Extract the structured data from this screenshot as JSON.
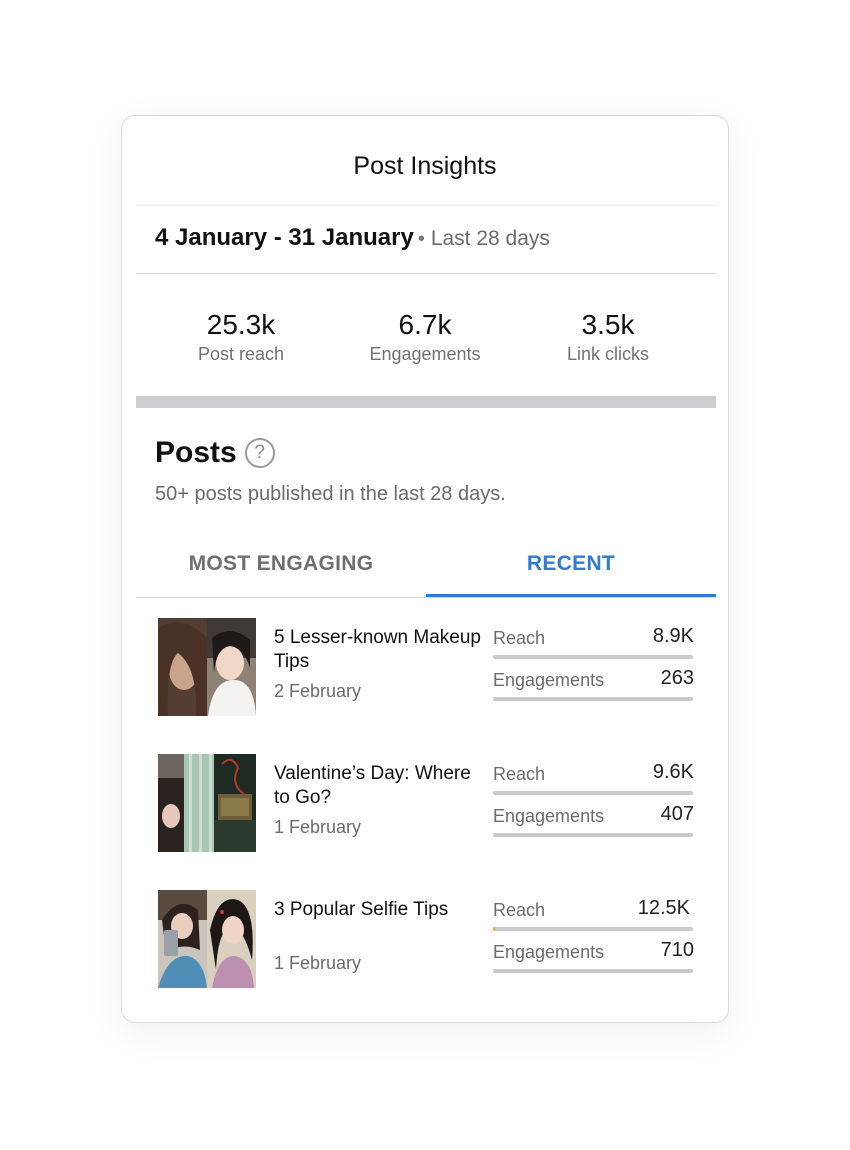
{
  "header": {
    "title": "Post Insights"
  },
  "date": {
    "range": "4 January - 31 January",
    "separator": "•",
    "period": "Last 28 days"
  },
  "stats": [
    {
      "value": "25.3k",
      "label": "Post reach"
    },
    {
      "value": "6.7k",
      "label": "Engagements"
    },
    {
      "value": "3.5k",
      "label": "Link clicks"
    }
  ],
  "posts": {
    "heading": "Posts",
    "help_glyph": "?",
    "subtitle": "50+ posts published in the last 28 days.",
    "tabs": [
      {
        "label": "MOST ENGAGING",
        "active": false
      },
      {
        "label": "RECENT",
        "active": true
      }
    ],
    "items": [
      {
        "title": "5 Lesser-known Makeup Tips",
        "date": "2 February",
        "reach_label": "Reach",
        "reach": "8.9K",
        "eng_label": "Engagements",
        "engagements": "263",
        "reach_fill": 0.0,
        "eng_fill": 0.0
      },
      {
        "title": "Valentine’s Day: Where to Go?",
        "date": "1 February",
        "reach_label": "Reach",
        "reach": "9.6K",
        "eng_label": "Engagements",
        "engagements": "407",
        "reach_fill": 0.0,
        "eng_fill": 0.0
      },
      {
        "title": "3 Popular Selfie Tips",
        "date": "1 February",
        "reach_label": "Reach",
        "reach": "12.5K",
        "eng_label": "Engagements",
        "engagements": "710",
        "reach_fill": 0.01,
        "eng_fill": 0.0
      }
    ]
  },
  "colors": {
    "accent": "#2f7ad6",
    "bar_track": "#c9c9cf",
    "bar_fill": "#f0a23a"
  }
}
